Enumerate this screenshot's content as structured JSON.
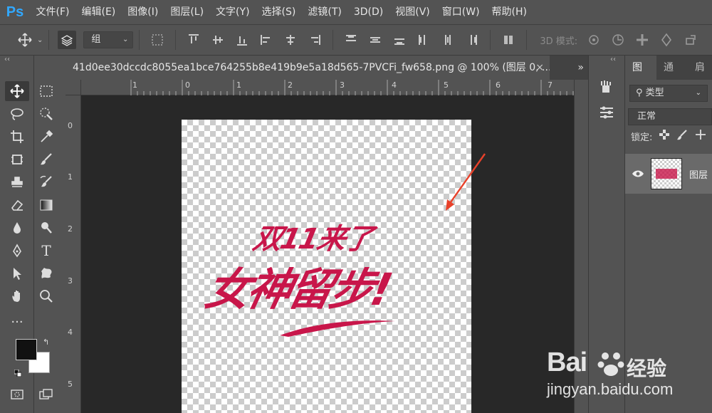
{
  "app": {
    "logo": "Ps"
  },
  "menu": [
    "文件(F)",
    "编辑(E)",
    "图像(I)",
    "图层(L)",
    "文字(Y)",
    "选择(S)",
    "滤镜(T)",
    "3D(D)",
    "视图(V)",
    "窗口(W)",
    "帮助(H)"
  ],
  "options": {
    "auto_select_value": "组",
    "mode_label": "3D 模式:"
  },
  "document": {
    "tab_title": "41d0ee30dccdc8055ea1bce764255b8e419b9e5a18d565-7PVCFi_fw658.png @ 100% (图层 0, ...",
    "close_glyph": "×",
    "more_glyph": "»"
  },
  "rulers": {
    "h_ticks": [
      "1",
      "0",
      "1",
      "2",
      "3",
      "4",
      "5",
      "6",
      "7"
    ],
    "v_ticks": [
      "0",
      "1",
      "2",
      "3",
      "4",
      "5"
    ]
  },
  "artwork": {
    "line1": "双11来了",
    "line2": "女神留步!"
  },
  "layers_panel": {
    "tabs": [
      "图层",
      "通道",
      "肩"
    ],
    "filter_label": "类型",
    "blend_mode": "正常",
    "lock_label": "锁定:",
    "layer_name": "图层"
  },
  "watermark": {
    "brand": "Bai",
    "brand_suffix": "经验",
    "url": "jingyan.baidu.com"
  },
  "colors": {
    "accent": "#31a8ff",
    "artwork": "#c8164a",
    "arrow": "#e8412a"
  }
}
